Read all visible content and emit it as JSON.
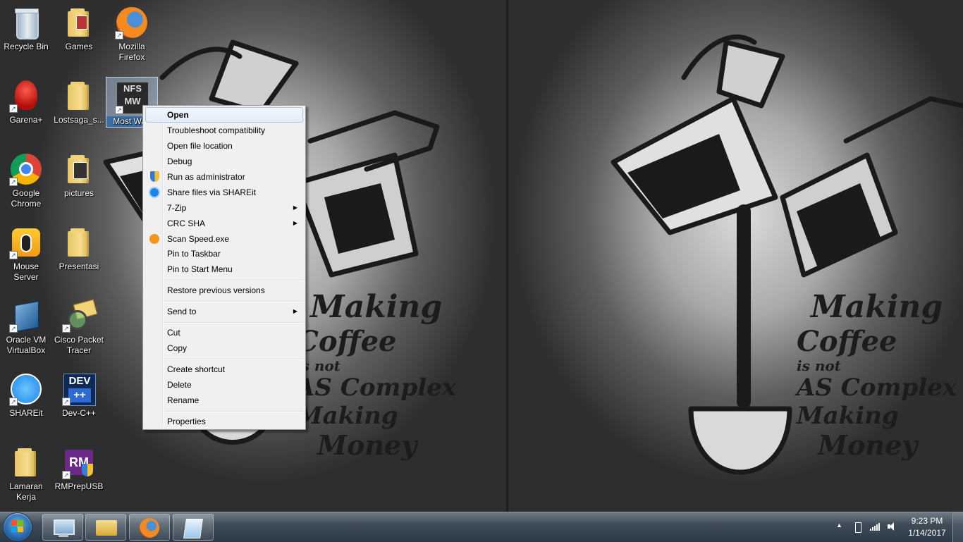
{
  "desktop_icons": [
    {
      "label": "Recycle Bin",
      "icon": "recycle-bin-icon"
    },
    {
      "label": "Games",
      "icon": "folder-icon"
    },
    {
      "label": "Mozilla Firefox",
      "icon": "firefox-icon"
    },
    {
      "label": "Garena+",
      "icon": "garena-icon"
    },
    {
      "label": "Lostsaga_s...",
      "icon": "folder-icon"
    },
    {
      "label": "Most Wan",
      "icon": "nfs-most-wanted-icon"
    },
    {
      "label": "Google Chrome",
      "icon": "chrome-icon"
    },
    {
      "label": "pictures",
      "icon": "folder-icon"
    },
    {
      "label": "Mouse Server",
      "icon": "mouse-server-icon"
    },
    {
      "label": "Presentasi",
      "icon": "folder-icon"
    },
    {
      "label": "Oracle VM VirtualBox",
      "icon": "virtualbox-icon"
    },
    {
      "label": "Cisco Packet Tracer",
      "icon": "packet-tracer-icon"
    },
    {
      "label": "SHAREit",
      "icon": "shareit-icon"
    },
    {
      "label": "Dev-C++",
      "icon": "devcpp-icon"
    },
    {
      "label": "Lamaran Kerja",
      "icon": "folder-icon"
    },
    {
      "label": "RMPrepUSB",
      "icon": "rmprepusb-icon"
    }
  ],
  "nfs_badge": {
    "line1": "NFS",
    "line2": "MW"
  },
  "dev_badge": {
    "line1": "DEV",
    "line2": "++"
  },
  "rm_badge": "RM",
  "context_menu": {
    "items": [
      {
        "label": "Open"
      },
      {
        "label": "Troubleshoot compatibility"
      },
      {
        "label": "Open file location"
      },
      {
        "label": "Debug"
      },
      {
        "label": "Run as administrator",
        "icon": "uac-shield-icon"
      },
      {
        "label": "Share files via SHAREit",
        "icon": "shareit-icon"
      },
      {
        "label": "7-Zip",
        "submenu": true
      },
      {
        "label": "CRC SHA",
        "submenu": true
      },
      {
        "label": "Scan Speed.exe",
        "icon": "avast-icon"
      },
      {
        "label": "Pin to Taskbar"
      },
      {
        "label": "Pin to Start Menu"
      },
      {
        "label": "Restore previous versions"
      },
      {
        "label": "Send to",
        "submenu": true
      },
      {
        "label": "Cut"
      },
      {
        "label": "Copy"
      },
      {
        "label": "Create shortcut"
      },
      {
        "label": "Delete"
      },
      {
        "label": "Rename"
      },
      {
        "label": "Properties"
      }
    ],
    "submenu_arrow": "▶",
    "highlighted": "Open"
  },
  "wallpaper_text": [
    "Making",
    "Coffee",
    "is not",
    "AS Complex",
    "Making",
    "Money"
  ],
  "taskbar": {
    "pinned": [
      {
        "name": "remote-desktop-icon"
      },
      {
        "name": "windows-explorer-icon"
      },
      {
        "name": "firefox-icon"
      },
      {
        "name": "notepad-icon"
      }
    ],
    "tray": {
      "show_hidden": "▲",
      "time": "9:23 PM",
      "date": "1/14/2017"
    }
  },
  "colors": {
    "menu_bg": "#f0f0f0",
    "highlight_border": "#a8c8ee",
    "taskbar": "#3f4c58"
  }
}
